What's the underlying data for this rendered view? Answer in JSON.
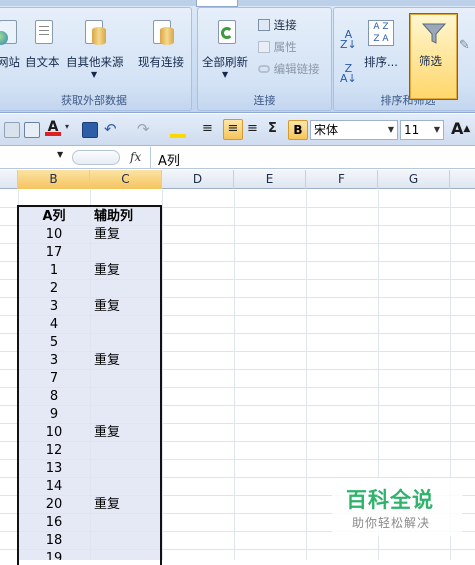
{
  "ribbon": {
    "groups": {
      "external": {
        "label": "获取外部数据",
        "buttons": [
          "网站",
          "自文本",
          "自其他来源",
          "现有连接"
        ]
      },
      "connections": {
        "label": "连接",
        "refresh_all": "全部刷新",
        "items": [
          "连接",
          "属性",
          "编辑链接"
        ]
      },
      "sort_filter": {
        "label": "排序和筛选",
        "sort": "排序...",
        "filter": "筛选",
        "sort_az": "A Z",
        "sort_za": "Z A"
      }
    }
  },
  "toolbar": {
    "bold": "B",
    "font_name": "宋体",
    "font_size": "11",
    "grow_font": "A",
    "sum": "Σ"
  },
  "formula_bar": {
    "name_box": "",
    "fx": "fx",
    "content": "A列"
  },
  "columns": [
    "B",
    "C",
    "D",
    "E",
    "F",
    "G"
  ],
  "table": {
    "headers": [
      "A列",
      "辅助列"
    ],
    "rows": [
      [
        "10",
        "重复"
      ],
      [
        "17",
        ""
      ],
      [
        "1",
        "重复"
      ],
      [
        "2",
        ""
      ],
      [
        "3",
        "重复"
      ],
      [
        "4",
        ""
      ],
      [
        "5",
        ""
      ],
      [
        "3",
        "重复"
      ],
      [
        "7",
        ""
      ],
      [
        "8",
        ""
      ],
      [
        "9",
        ""
      ],
      [
        "10",
        "重复"
      ],
      [
        "12",
        ""
      ],
      [
        "13",
        ""
      ],
      [
        "14",
        ""
      ],
      [
        "20",
        "重复"
      ],
      [
        "16",
        ""
      ],
      [
        "18",
        ""
      ],
      [
        "19",
        ""
      ]
    ]
  },
  "watermark": {
    "title": "百科全说",
    "subtitle": "助你轻松解决"
  },
  "colors": {
    "selected_header": "#f5c45e",
    "watermark": "#2fb36c",
    "filter_highlight": "#ffd76b"
  }
}
